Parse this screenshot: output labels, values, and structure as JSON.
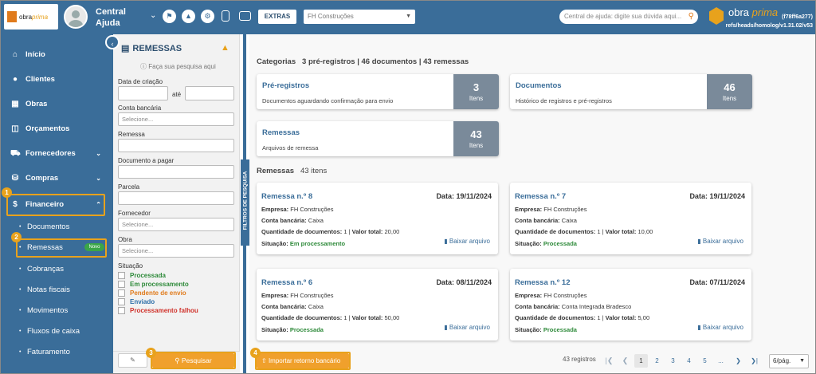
{
  "topbar": {
    "logo_text_a": "obra",
    "logo_text_b": "prima",
    "user_name": "Central Ajuda",
    "extras_label": "EXTRAS",
    "company_select": "FH Construções",
    "help_search_placeholder": "Central de ajuda: digite sua dúvida aqui...",
    "brand_a": "obra",
    "brand_b": "prima",
    "version_hash": "(f78ff6a277)",
    "version_ref": "refs/heads/homolog/v1.31.02/v53"
  },
  "nav": {
    "items": [
      {
        "label": "Início",
        "icon": "home-icon"
      },
      {
        "label": "Clientes",
        "icon": "user-icon"
      },
      {
        "label": "Obras",
        "icon": "building-icon"
      },
      {
        "label": "Orçamentos",
        "icon": "calculator-icon"
      },
      {
        "label": "Fornecedores",
        "icon": "truck-icon"
      },
      {
        "label": "Compras",
        "icon": "cart-icon"
      },
      {
        "label": "Financeiro",
        "icon": "dollar-icon"
      }
    ],
    "subitems": [
      "Documentos",
      "Remessas",
      "Cobranças",
      "Notas fiscais",
      "Movimentos",
      "Fluxos de caixa",
      "Faturamento"
    ],
    "novo_badge": "Novo"
  },
  "callouts": [
    "1",
    "2",
    "3",
    "4"
  ],
  "filters": {
    "title": "REMESSAS",
    "hint": "Faça sua pesquisa aqui",
    "date_label": "Data de criação",
    "date_sep": "até",
    "bank_label": "Conta bancária",
    "bank_placeholder": "Selecione...",
    "remessa_label": "Remessa",
    "doc_label": "Documento a pagar",
    "parcela_label": "Parcela",
    "fornecedor_label": "Fornecedor",
    "fornecedor_placeholder": "Selecione...",
    "obra_label": "Obra",
    "obra_placeholder": "Selecione...",
    "situacao_label": "Situação",
    "situacoes": [
      {
        "label": "Processada",
        "color": "#2e8a3a"
      },
      {
        "label": "Em processamento",
        "color": "#2e8a3a"
      },
      {
        "label": "Pendente de envio",
        "color": "#e07b1c"
      },
      {
        "label": "Enviado",
        "color": "#2c6ea8"
      },
      {
        "label": "Processamento falhou",
        "color": "#d0322b"
      }
    ],
    "search_label": "Pesquisar",
    "side_tab": "FILTROS DE PESQUISA"
  },
  "main": {
    "categories_label": "Categorias",
    "categories_summary": "3 pré-registros | 46 documentos | 43 remessas",
    "cards": [
      {
        "title": "Pré-registros",
        "desc": "Documentos aguardando confirmação para envio",
        "count": "3",
        "unit": "Itens"
      },
      {
        "title": "Documentos",
        "desc": "Histórico de registros e pré-registros",
        "count": "46",
        "unit": "Itens"
      },
      {
        "title": "Remessas",
        "desc": "Arquivos de remessa",
        "count": "43",
        "unit": "Itens"
      }
    ],
    "remessas_label": "Remessas",
    "remessas_count": "43 itens",
    "remessas": [
      {
        "title": "Remessa n.º 8",
        "date": "Data: 19/11/2024",
        "empresa": "FH Construções",
        "conta": "Caixa",
        "qtd": "1",
        "valor": "20,00",
        "situacao": "Em processamento"
      },
      {
        "title": "Remessa n.º 7",
        "date": "Data: 19/11/2024",
        "empresa": "FH Construções",
        "conta": "Caixa",
        "qtd": "1",
        "valor": "10,00",
        "situacao": "Processada"
      },
      {
        "title": "Remessa n.º 6",
        "date": "Data: 08/11/2024",
        "empresa": "FH Construções",
        "conta": "Caixa",
        "qtd": "1",
        "valor": "50,00",
        "situacao": "Processada"
      },
      {
        "title": "Remessa n.º 12",
        "date": "Data: 07/11/2024",
        "empresa": "FH Construções",
        "conta": "Conta Integrada Bradesco",
        "qtd": "1",
        "valor": "5,00",
        "situacao": "Processada"
      }
    ],
    "labels": {
      "empresa": "Empresa:",
      "conta": "Conta bancária:",
      "qtd": "Quantidade de documentos:",
      "valor": "Valor total:",
      "situacao": "Situação:",
      "download": "Baixar arquivo"
    },
    "import_label": "Importar retorno bancário",
    "total_records": "43 registros",
    "pages": [
      "1",
      "2",
      "3",
      "4",
      "5",
      "..."
    ],
    "current_page": "1",
    "per_page": "6/pág."
  }
}
